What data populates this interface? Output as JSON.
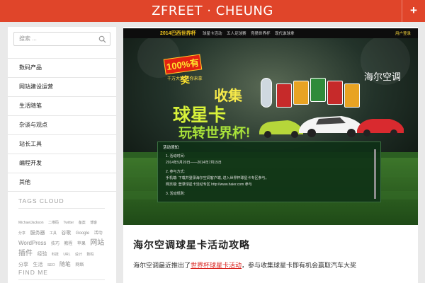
{
  "header": {
    "site_title": "ZFREET · CHEUNG",
    "plus_label": "+"
  },
  "colors": {
    "accent": "#e0452a",
    "link": "#d9231e"
  },
  "sidebar": {
    "search_placeholder": "搜索 ...",
    "search_icon": "search-icon",
    "categories": [
      "数码产品",
      "网站建设运营",
      "生活随笔",
      "杂谈与观点",
      "站长工具",
      "编程开发",
      "其他"
    ],
    "tags_title": "TAGS CLOUD",
    "tags": [
      {
        "text": "MichaelJackson",
        "size": 1
      },
      {
        "text": "二维码",
        "size": 1
      },
      {
        "text": "Twitter",
        "size": 1
      },
      {
        "text": "备案",
        "size": 1
      },
      {
        "text": "博客",
        "size": 1
      },
      {
        "text": "分享",
        "size": 1
      },
      {
        "text": "服务器",
        "size": 3
      },
      {
        "text": "工具",
        "size": 1
      },
      {
        "text": "谷歌",
        "size": 3
      },
      {
        "text": "Google",
        "size": 2
      },
      {
        "text": "活动",
        "size": 2
      },
      {
        "text": "WordPress",
        "size": 4
      },
      {
        "text": "技巧",
        "size": 2
      },
      {
        "text": "教程",
        "size": 2
      },
      {
        "text": "苹果",
        "size": 2
      },
      {
        "text": "网站",
        "size": 5
      },
      {
        "text": "插件",
        "size": 5
      },
      {
        "text": "经验",
        "size": 3
      },
      {
        "text": "科技",
        "size": 1
      },
      {
        "text": "URL",
        "size": 1
      },
      {
        "text": "设计",
        "size": 1
      },
      {
        "text": "数码",
        "size": 1
      },
      {
        "text": "分享",
        "size": 3
      },
      {
        "text": "生活",
        "size": 3
      },
      {
        "text": "SEO",
        "size": 1
      },
      {
        "text": "随笔",
        "size": 4
      },
      {
        "text": "网络",
        "size": 2
      }
    ],
    "find_me_title": "FIND ME"
  },
  "banner": {
    "nav_logo": "2014巴西世界杯",
    "nav_items": [
      "球星卡活动",
      "五人足球赛",
      "竞猜世界杯",
      "现代谁球拿"
    ],
    "nav_login": "用户登录",
    "gift_badge": "100%有奖",
    "gift_sub": "千万大奖 等你来拿",
    "slogan_1": "球星卡",
    "slogan_2": "收集",
    "slogan_3": "玩转世界杯!",
    "brand": "海尔空调",
    "info_title": "活动须知:",
    "info_lines": [
      "1. 活动时间:",
      "   2014年5月20日——2014年7月15日",
      "2. 参与方式:",
      "   手机端: 下载并登录海尔空调客户端, 进入世界杯球星卡专区参与。",
      "   网页端: 登录球星卡活动专区 http://www.haier.com 参与",
      "3. 活动规则:"
    ]
  },
  "post": {
    "title": "海尔空调球星卡活动攻略",
    "excerpt_before": "海尔空调最近推出了",
    "excerpt_link": "世界杯球星卡活动",
    "excerpt_after": "，参与收集球星卡即有机会赢取汽车大奖"
  }
}
